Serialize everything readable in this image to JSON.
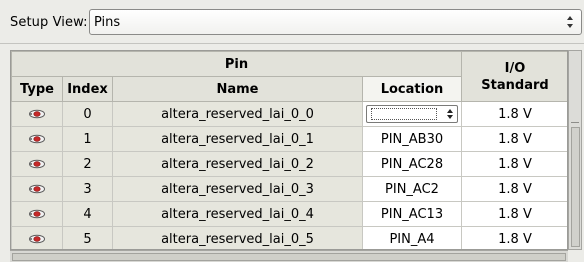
{
  "setup": {
    "label": "Setup View:",
    "selected": "Pins"
  },
  "table": {
    "group_header": "Pin",
    "columns": {
      "type": "Type",
      "index": "Index",
      "name": "Name",
      "location": "Location",
      "io_standard_line1": "I/O",
      "io_standard_line2": "Standard"
    },
    "rows": [
      {
        "type_icon": "pin-type-icon",
        "index": "0",
        "name": "altera_reserved_lai_0_0",
        "location": "",
        "io_standard": "1.8 V"
      },
      {
        "type_icon": "pin-type-icon",
        "index": "1",
        "name": "altera_reserved_lai_0_1",
        "location": "PIN_AB30",
        "io_standard": "1.8 V"
      },
      {
        "type_icon": "pin-type-icon",
        "index": "2",
        "name": "altera_reserved_lai_0_2",
        "location": "PIN_AC28",
        "io_standard": "1.8 V"
      },
      {
        "type_icon": "pin-type-icon",
        "index": "3",
        "name": "altera_reserved_lai_0_3",
        "location": "PIN_AC2",
        "io_standard": "1.8 V"
      },
      {
        "type_icon": "pin-type-icon",
        "index": "4",
        "name": "altera_reserved_lai_0_4",
        "location": "PIN_AC13",
        "io_standard": "1.8 V"
      },
      {
        "type_icon": "pin-type-icon",
        "index": "5",
        "name": "altera_reserved_lai_0_5",
        "location": "PIN_A4",
        "io_standard": "1.8 V"
      }
    ]
  }
}
